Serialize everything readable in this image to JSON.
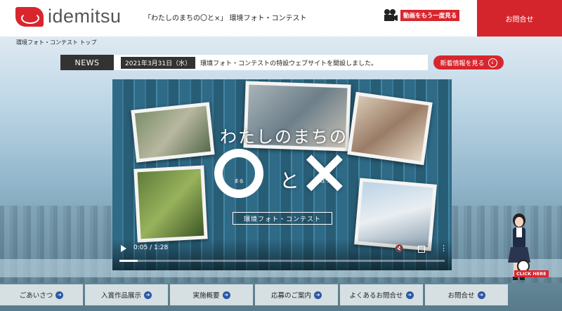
{
  "header": {
    "logo_text": "idemitsu",
    "site_title": "「わたしのまちの〇と×」 環境フォト・コンテスト",
    "video_again_label": "動画をもう一度見る",
    "contact_label": "お問合せ"
  },
  "breadcrumb": "環境フォト・コンテスト トップ",
  "news": {
    "tag": "NEWS",
    "date": "2021年3月31日（水）",
    "message": "環境フォト・コンテストの特設ウェブサイトを開設しました。",
    "more_label": "新着情報を見る",
    "more_icon": "↓"
  },
  "video": {
    "title": "わたしのまちの",
    "ruby_maru": "まる",
    "to": "と",
    "batsu": "×",
    "ruby_batsu": "ばつ",
    "subtitle": "環境フォト・コンテスト",
    "time": "0:05 / 1:28",
    "progress": 0.057
  },
  "click_here": "CLICK HERE",
  "nav": {
    "items": [
      {
        "label": "ごあいさつ"
      },
      {
        "label": "入賞作品展示"
      },
      {
        "label": "実施概要"
      },
      {
        "label": "応募のご案内"
      },
      {
        "label": "よくあるお問合せ"
      },
      {
        "label": "お問合せ"
      }
    ],
    "arrow": "➜"
  },
  "colors": {
    "brand_red": "#d8262e",
    "nav_arrow": "#2b58a8"
  }
}
